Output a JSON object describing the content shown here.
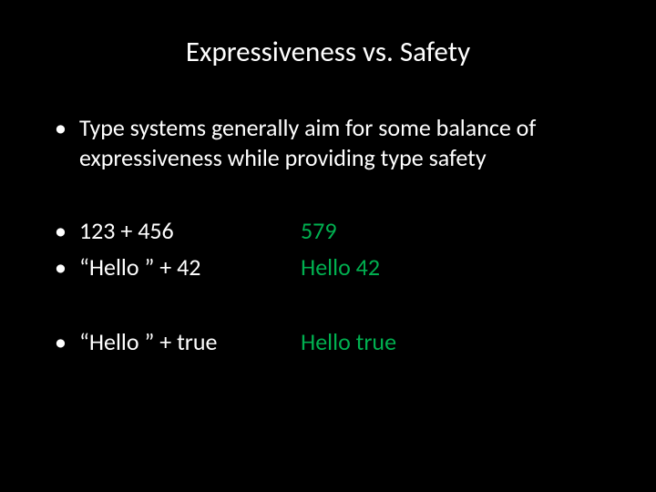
{
  "title": "Expressiveness vs. Safety",
  "intro": "Type systems generally aim for some balance of expressiveness while providing type safety",
  "examples_group1": [
    {
      "expr": "123 + 456",
      "result": "579"
    },
    {
      "expr": "“Hello ” + 42",
      "result": "Hello 42"
    }
  ],
  "examples_group2": [
    {
      "expr": "“Hello ” + true",
      "result": "Hello true"
    }
  ],
  "bullet_char": "•"
}
